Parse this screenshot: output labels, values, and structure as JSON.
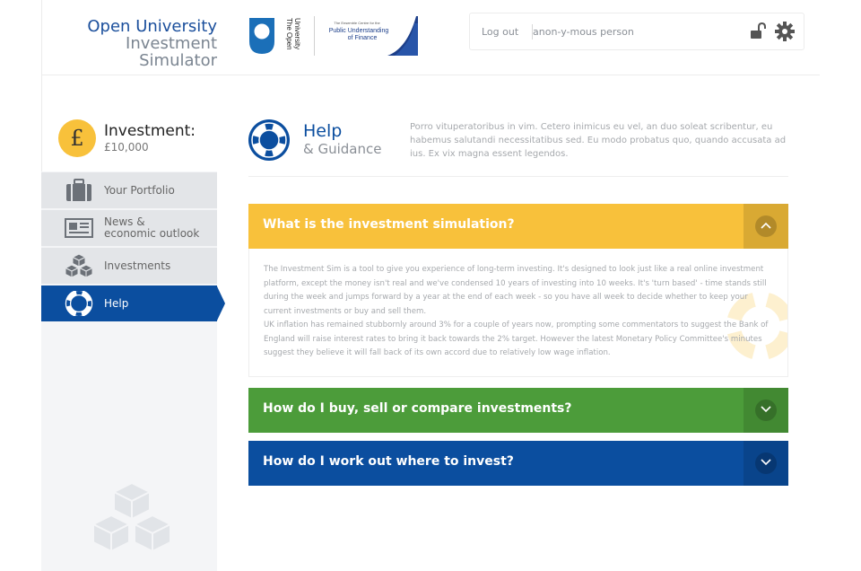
{
  "header": {
    "brand_line1": "Open University",
    "brand_line2": "Investment Simulator",
    "ou_logo_text_1": "The Open",
    "ou_logo_text_2": "University",
    "partner_small": "The Ensemble Centre for the",
    "partner_line1": "Public Understanding",
    "partner_line2": "of Finance",
    "logout_label": "Log out",
    "username": "anon-y-mous person"
  },
  "sidebar": {
    "investment_label": "Investment:",
    "investment_value": "£10,000",
    "currency_symbol": "£",
    "items": [
      {
        "label": "Your Portfolio",
        "icon": "briefcase-icon"
      },
      {
        "label_line1": "News &",
        "label_line2": "economic outlook",
        "icon": "newspaper-icon"
      },
      {
        "label": "Investments",
        "icon": "cubes-icon"
      },
      {
        "label": "Help",
        "icon": "lifebuoy-icon",
        "active": true
      }
    ]
  },
  "main": {
    "title": "Help",
    "subtitle": "& Guidance",
    "intro": "Porro vituperatoribus in vim. Cetero inimicus eu vel, an duo soleat scribentur, eu habemus salutandi necessitatibus sed. Eu modo probatus quo, quando accusata ad ius. Ex vix magna essent legendos.",
    "accordion": [
      {
        "title": "What is the investment simulation?",
        "expanded": true,
        "color": "#f8c13b",
        "body_p1": "The Investment Sim is a tool to give you experience of long-term investing.  It's designed to look just like a real online investment platform, except the money isn't real and we've condensed 10 years of investing into 10 weeks.  It's 'turn based' - time stands still during the week and jumps forward by a year at the end of each week - so you have all week to decide whether to keep your current investments or buy and sell them.",
        "body_p2": "UK inflation has remained stubbornly around 3% for a couple of years now, prompting some commentators to suggest the Bank of England will raise interest rates to bring it back towards the 2% target.  However the latest Monetary Policy Committee's minutes suggest they believe it will fall back of its own accord due to relatively low wage inflation."
      },
      {
        "title": "How do I buy, sell or compare investments?",
        "expanded": false,
        "color": "#4c9c3a"
      },
      {
        "title": "How do I work out where to invest?",
        "expanded": false,
        "color": "#0b4e9f"
      }
    ]
  },
  "colors": {
    "primary_blue": "#0b4e9f",
    "accent_yellow": "#f8c13b",
    "accent_green": "#4c9c3a"
  }
}
